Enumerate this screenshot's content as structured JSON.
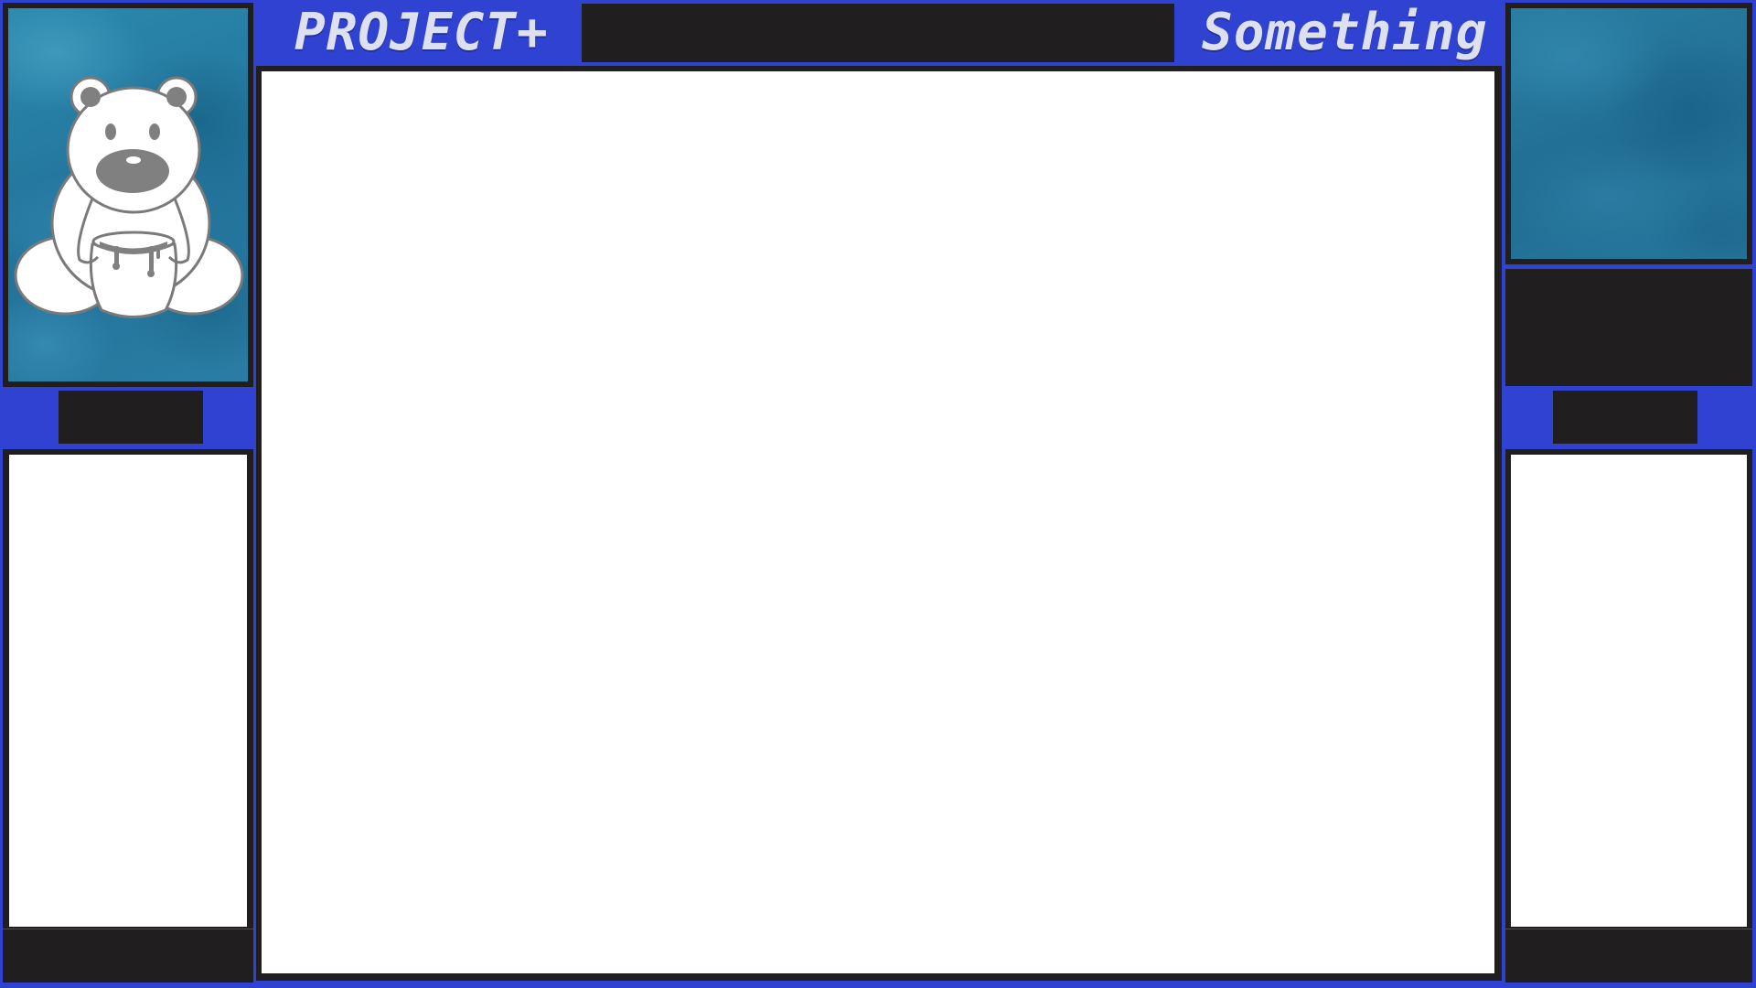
{
  "header": {
    "left_title": "PROJECT+",
    "right_title": "Something"
  },
  "colors": {
    "frame_blue": "#2f42d1",
    "panel_dark": "#201e1f",
    "panel_white": "#ffffff",
    "art_blue": "#2a7ea1",
    "title_text": "#dde0ee"
  },
  "icons": {
    "left_art": "bear-with-honey-pot-icon"
  }
}
